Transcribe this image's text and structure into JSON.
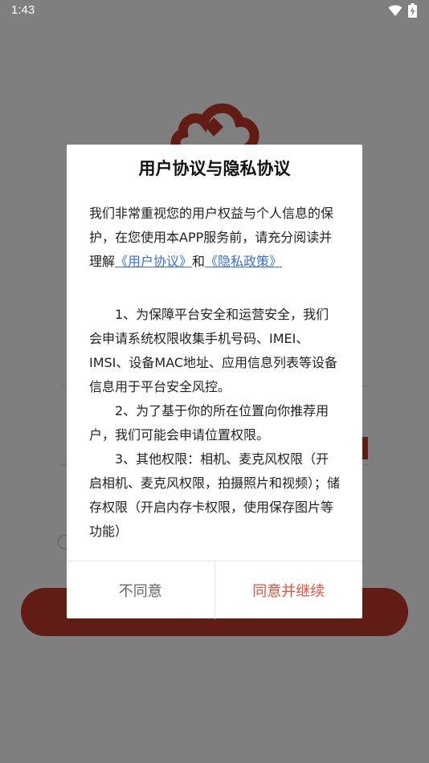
{
  "status_bar": {
    "time": "1:43",
    "icons": [
      "wifi-icon",
      "battery-charging-icon"
    ]
  },
  "dialog": {
    "title": "用户协议与隐私协议",
    "intro_text": "我们非常重视您的用户权益与个人信息的保护，在您使用本APP服务前，请充分阅读并理解",
    "user_agreement_link": "《用户协议》",
    "and_text": "和",
    "privacy_policy_link": "《隐私政策》",
    "items": [
      "1、为保障平台安全和运营安全，我们会申请系统权限收集手机号码、IMEI、IMSI、设备MAC地址、应用信息列表等设备信息用于平台安全风控。",
      "2、为了基于你的所在位置向你推荐用户，我们可能会申请位置权限。",
      "3、其他权限：相机、麦克风权限（开启相机、麦克风权限，拍摄照片和视频）；储存权限（开启内存卡权限，使用保存图片等功能）"
    ],
    "disagree_label": "不同意",
    "agree_label": "同意并继续"
  },
  "colors": {
    "brand_red": "#c0392b",
    "agree_text": "#e8503a",
    "link_blue": "#3a6fd8",
    "scrim": "rgba(0,0,0,0.5)"
  }
}
